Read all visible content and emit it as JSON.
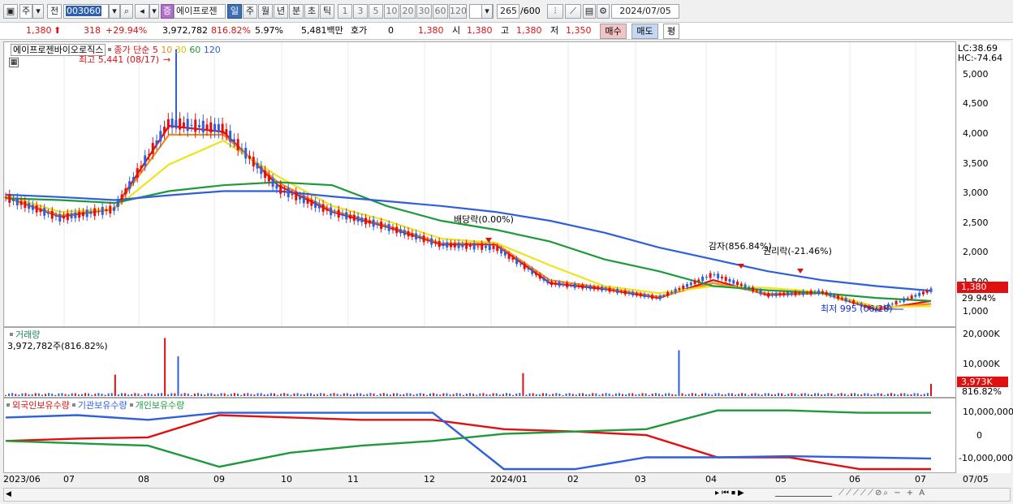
{
  "toolbar": {
    "market": "주",
    "prev": "전",
    "code": "003060",
    "badge": "증",
    "name": "에이프로젠",
    "periods": [
      "일",
      "주",
      "월",
      "년",
      "분",
      "초",
      "틱"
    ],
    "active_period": "일",
    "numbers": [
      "1",
      "3",
      "5",
      "10",
      "20",
      "30",
      "60",
      "120"
    ],
    "count": "265",
    "total": "/600",
    "date": "2024/07/05"
  },
  "quote": {
    "price": "1,380",
    "change": "318",
    "change_pct": "+29.94%",
    "volume": "3,972,782",
    "volume_pct": "816.82%",
    "turnover": "5.97%",
    "amount": "5,481백만",
    "hoga_label": "호가",
    "hoga_value": "0",
    "hoga_price": "1,380",
    "open_label": "시",
    "open": "1,380",
    "high_label": "고",
    "high": "1,380",
    "low_label": "저",
    "low": "1,350",
    "buy": "매수",
    "sell": "매도",
    "avg": "평"
  },
  "price_panel": {
    "name_box": "에이프로젠바이오로직스",
    "ma_title": "종가 단순",
    "ma_periods": [
      "5",
      "10",
      "30",
      "60",
      "120"
    ],
    "ma_colors": [
      "#e01010",
      "#f08c1c",
      "#f2e21c",
      "#1e9a3c",
      "#2f5fdc"
    ],
    "high_note": "최고 5,441 (08/17)",
    "low_note": "최저 995 (06/28)",
    "event1": "배당락(0.00%)",
    "event2": "감자(856.84%)",
    "event3": "권리락(-21.46%)",
    "lc": "LC:38.69",
    "hc": "HC:-74.64",
    "cur_price": "1,380",
    "cur_pct": "29.94%"
  },
  "volume_panel": {
    "title": "거래량",
    "subtitle": "3,972,782주(816.82%)",
    "cur": "3,973K",
    "cur_pct": "816.82%"
  },
  "holding_panel": {
    "foreign": "외국인보유수량",
    "inst": "기관보유수량",
    "indiv": "개인보유수량"
  },
  "chart_data": [
    {
      "type": "candlestick",
      "x_ticks": [
        "2023/06",
        "07",
        "08",
        "09",
        "10",
        "11",
        "12",
        "2024/01",
        "02",
        "03",
        "04",
        "05",
        "06",
        "07",
        "07/05"
      ],
      "y_ticks": [
        "1,000",
        "1,500",
        "2,000",
        "2,500",
        "3,000",
        "3,500",
        "4,000",
        "4,500",
        "5,000"
      ],
      "ylim": [
        800,
        5450
      ],
      "series": [
        {
          "name": "종가",
          "months": [
            "06",
            "07",
            "08a",
            "08b",
            "08c",
            "09",
            "10",
            "11",
            "12",
            "01a",
            "01b",
            "02",
            "03",
            "03b",
            "04",
            "05",
            "06",
            "07"
          ],
          "values": [
            2950,
            2600,
            2750,
            4200,
            4100,
            3100,
            2700,
            2450,
            2150,
            2100,
            1500,
            1400,
            1250,
            1650,
            1300,
            1350,
            1050,
            1380
          ]
        },
        {
          "name": "5",
          "values": [
            2950,
            2620,
            2750,
            4150,
            4050,
            3150,
            2700,
            2450,
            2150,
            2150,
            1500,
            1400,
            1250,
            1550,
            1300,
            1330,
            1050,
            1200
          ]
        },
        {
          "name": "10",
          "values": [
            2950,
            2640,
            2750,
            4000,
            4000,
            3200,
            2720,
            2470,
            2170,
            2170,
            1550,
            1420,
            1270,
            1500,
            1320,
            1330,
            1070,
            1150
          ]
        },
        {
          "name": "30",
          "values": [
            2980,
            2700,
            2750,
            3500,
            3900,
            3300,
            2800,
            2550,
            2250,
            2180,
            1800,
            1450,
            1330,
            1450,
            1420,
            1350,
            1100,
            1110
          ]
        },
        {
          "name": "60",
          "values": [
            2930,
            2900,
            2850,
            3050,
            3150,
            3200,
            3150,
            2800,
            2550,
            2400,
            2200,
            1900,
            1700,
            1450,
            1380,
            1330,
            1250,
            1200
          ]
        },
        {
          "name": "120",
          "values": [
            2990,
            2950,
            2900,
            2980,
            3050,
            3050,
            2960,
            2880,
            2800,
            2700,
            2550,
            2350,
            2100,
            1900,
            1700,
            1550,
            1450,
            1370
          ]
        }
      ]
    },
    {
      "type": "bar",
      "title": "거래량",
      "y_ticks": [
        "10,000K",
        "20,000K"
      ],
      "ylim": [
        0,
        21000
      ],
      "spikes": [
        {
          "x": "07",
          "value": 7000
        },
        {
          "x": "08",
          "value": 19000
        },
        {
          "x": "08b",
          "value": 13000
        },
        {
          "x": "2024/01",
          "value": 7500
        },
        {
          "x": "03",
          "value": 15000
        },
        {
          "x": "07",
          "value": 3973
        }
      ]
    },
    {
      "type": "line",
      "y_ticks": [
        "10,000,000",
        "0",
        "-10,000,000"
      ],
      "ylim": [
        -14000000,
        14000000
      ],
      "series": [
        {
          "name": "외국인보유수량",
          "values": [
            -2000000,
            -1000000,
            -500000,
            9000000,
            8000000,
            7000000,
            7000000,
            3000000,
            2000000,
            500000,
            -9000000,
            -9000000,
            -14000000,
            -14000000
          ]
        },
        {
          "name": "기관보유수량",
          "values": [
            8000000,
            9000000,
            7000000,
            10000000,
            10000000,
            10000000,
            10000000,
            -14000000,
            -14000000,
            -9000000,
            -9000000,
            -8500000,
            -9000000,
            -9500000
          ]
        },
        {
          "name": "개인보유수량",
          "values": [
            -2000000,
            -3000000,
            -4000000,
            -13000000,
            -7000000,
            -4000000,
            -2000000,
            1000000,
            2000000,
            3000000,
            11000000,
            11000000,
            10000000,
            10000000
          ]
        }
      ]
    }
  ]
}
